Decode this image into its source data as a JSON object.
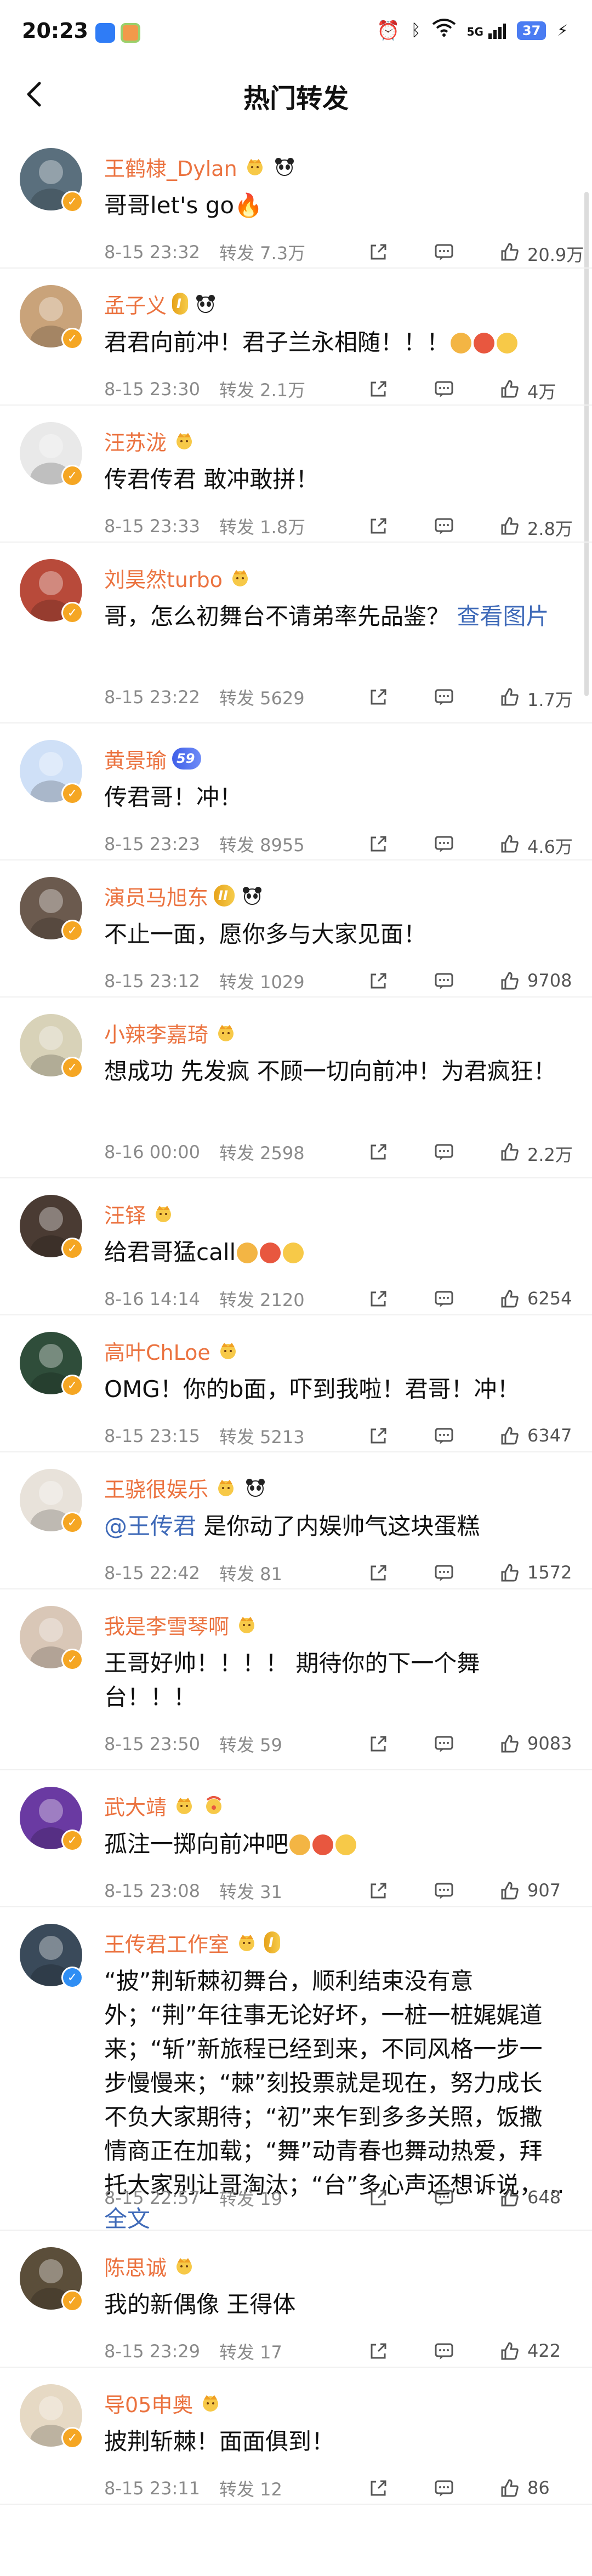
{
  "status_bar": {
    "time": "20:23",
    "battery": "37",
    "signal": "5G"
  },
  "nav": {
    "title": "热门转发"
  },
  "colors": {
    "username": "#eb7340",
    "verify_orange": "#f5a623",
    "verify_blue": "#2f8ef4",
    "link": "#3f6ab8"
  },
  "comments": [
    {
      "username": "王鹤棣_Dylan",
      "text": "哥哥let's go🔥",
      "time": "8-15 23:32",
      "reposts": "转发 7.3万",
      "likes": "20.9万",
      "verify": "orange",
      "badges": [
        "crown",
        "panda"
      ]
    },
    {
      "username": "孟子义",
      "text": "君君向前冲！君子兰永相随！！！",
      "time": "8-15 23:30",
      "reposts": "转发 2.1万",
      "likes": "4万",
      "verify": "orange",
      "level": "I",
      "level_color": "gold",
      "badges": [
        "panda"
      ]
    },
    {
      "username": "汪苏泷",
      "text": "传君传君 敢冲敢拼！",
      "time": "8-15 23:33",
      "reposts": "转发 1.8万",
      "likes": "2.8万",
      "verify": "orange",
      "badges": [
        "crown"
      ]
    },
    {
      "username": "刘昊然turbo",
      "text": "哥，怎么初舞台不请弟率先品鉴？",
      "link": "查看图片",
      "time": "8-15 23:22",
      "reposts": "转发 5629",
      "likes": "1.7万",
      "verify": "orange",
      "badges": [
        "crown"
      ]
    },
    {
      "username": "黄景瑜",
      "text": "传君哥！冲！",
      "time": "8-15 23:23",
      "reposts": "转发 8955",
      "likes": "4.6万",
      "verify": "orange",
      "level": "59",
      "level_color": "blue",
      "badges": []
    },
    {
      "username": "演员马旭东",
      "text": "不止一面，愿你多与大家见面！",
      "time": "8-15 23:12",
      "reposts": "转发 1029",
      "likes": "9708",
      "verify": "orange",
      "level": "II",
      "level_color": "gold",
      "badges": [
        "panda"
      ]
    },
    {
      "username": "小辣李嘉琦",
      "text": "想成功 先发疯 不顾一切向前冲！为君疯狂！",
      "time": "8-16 00:00",
      "reposts": "转发 2598",
      "likes": "2.2万",
      "verify": "orange",
      "badges": [
        "crown"
      ]
    },
    {
      "username": "汪铎",
      "text": "给君哥猛call",
      "time": "8-16 14:14",
      "reposts": "转发 2120",
      "likes": "6254",
      "verify": "orange",
      "badges": [
        "crown"
      ]
    },
    {
      "username": "高叶ChLoe",
      "text": "OMG！你的b面，吓到我啦！君哥！冲！",
      "time": "8-15 23:15",
      "reposts": "转发 5213",
      "likes": "6347",
      "verify": "orange",
      "badges": [
        "crown"
      ]
    },
    {
      "username": "王骁很娱乐",
      "mention": "@王传君",
      "text": " 是你动了内娱帅气这块蛋糕",
      "time": "8-15 22:42",
      "reposts": "转发 81",
      "likes": "1572",
      "verify": "orange",
      "badges": [
        "crown",
        "panda"
      ]
    },
    {
      "username": "我是李雪琴啊",
      "text": "王哥好帅！！！！ 期待你的下一个舞台！！！",
      "time": "8-15 23:50",
      "reposts": "转发 59",
      "likes": "9083",
      "verify": "orange",
      "badges": [
        "crown"
      ]
    },
    {
      "username": "武大靖",
      "text": "孤注一掷向前冲吧",
      "time": "8-15 23:08",
      "reposts": "转发 31",
      "likes": "907",
      "verify": "orange",
      "badges": [
        "crown",
        "clown"
      ]
    },
    {
      "username": "王传君工作室",
      "text": "“披”荆斩棘初舞台，顺利结束没有意外；“荆”年往事无论好坏，一桩一桩娓娓道来；“斩”新旅程已经到来，不同风格一步一步慢慢来；“棘”刻投票就是现在，努力成长不负大家期待；“初”来乍到多多关照，饭撒情商正在加载；“舞”动青春也舞动热爱，拜托大家别让哥淘汰；“台”多心声还想诉说，...",
      "link": "全文",
      "time": "8-15 22:57",
      "reposts": "转发 19",
      "likes": "648",
      "verify": "blue",
      "level": "I",
      "level_color": "gold",
      "badges": [
        "crown"
      ]
    },
    {
      "username": "陈思诚",
      "text": "我的新偶像 王得体",
      "time": "8-15 23:29",
      "reposts": "转发 17",
      "likes": "422",
      "verify": "orange",
      "badges": [
        "crown"
      ]
    },
    {
      "username": "导05申奥",
      "text": "披荆斩棘！面面俱到！",
      "time": "8-15 23:11",
      "reposts": "转发 12",
      "likes": "86",
      "verify": "orange",
      "badges": [
        "crown"
      ]
    }
  ]
}
